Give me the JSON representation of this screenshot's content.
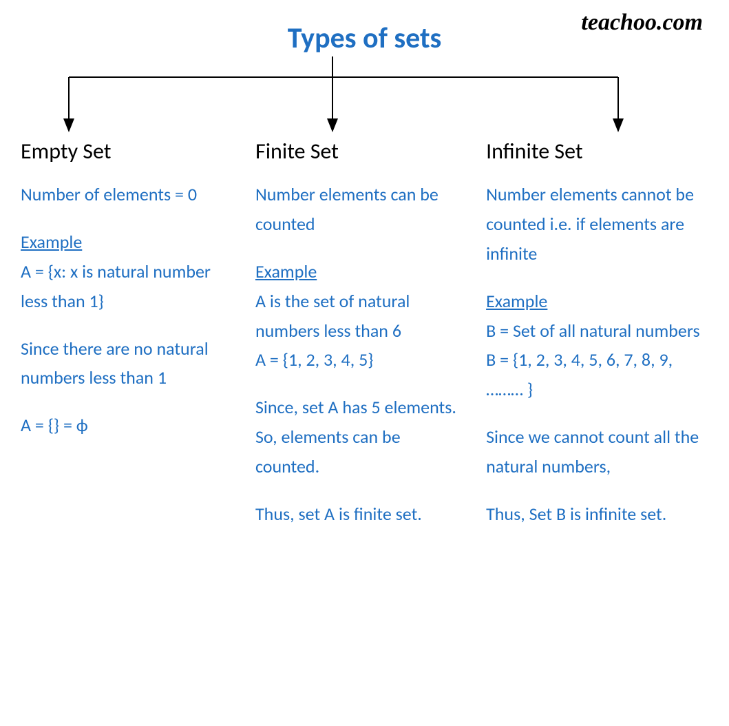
{
  "watermark": "teachoo.com",
  "title": "Types of sets",
  "colors": {
    "accent": "#1f6fc2"
  },
  "columns": {
    "empty": {
      "heading": "Empty Set",
      "definition": "Number of elements = 0",
      "example_label": "Example",
      "example_set": "A = {x: x is natural number less than 1}",
      "reason": "Since there are no natural numbers less than 1",
      "conclusion": "A = {} = ϕ"
    },
    "finite": {
      "heading": "Finite Set",
      "definition": "Number elements can be counted",
      "example_label": "Example",
      "example_desc": "A is the set of natural numbers less than 6",
      "example_set": "A = {1, 2, 3, 4, 5}",
      "reason": "Since, set A has 5 elements. So, elements can be counted.",
      "conclusion": "Thus, set A is finite set."
    },
    "infinite": {
      "heading": "Infinite Set",
      "definition": "Number elements cannot be counted i.e. if elements are infinite",
      "example_label": "Example",
      "example_desc": "B = Set of all natural numbers",
      "example_set": "B = {1, 2, 3, 4, 5, 6, 7, 8, 9, ……… }",
      "reason": "Since we cannot count all the natural numbers,",
      "conclusion": "Thus, Set B is infinite set."
    }
  }
}
